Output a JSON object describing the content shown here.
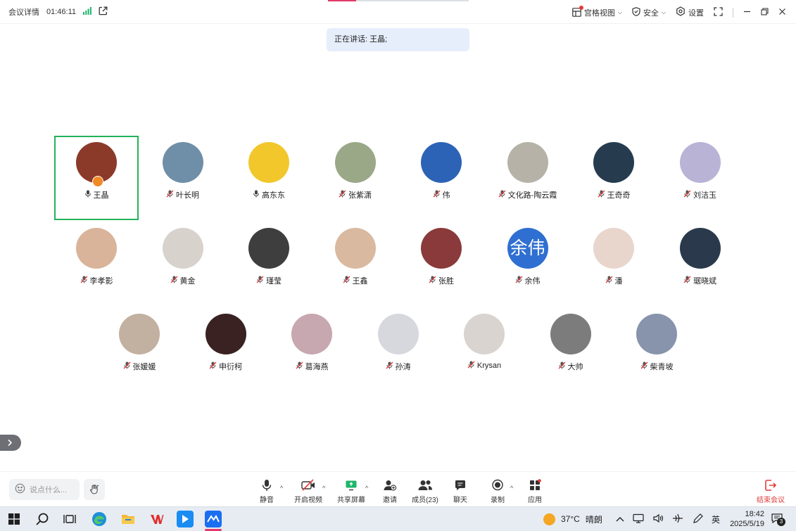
{
  "topbar": {
    "title": "会议详情",
    "timer": "01:46:11",
    "layout_label": "宫格视图",
    "security_label": "安全",
    "settings_label": "设置"
  },
  "speaking": {
    "text": "正在讲话: 王晶;"
  },
  "participants": [
    {
      "name": "王晶",
      "mic": "on",
      "active": true,
      "host": true,
      "color": "#8b3a2a"
    },
    {
      "name": "叶长明",
      "mic": "muted",
      "color": "#6f8fa8"
    },
    {
      "name": "高东东",
      "mic": "on",
      "color": "#f2c72c"
    },
    {
      "name": "张紫潇",
      "mic": "muted",
      "color": "#9aa888"
    },
    {
      "name": "伟",
      "mic": "muted",
      "color": "#2d63b6"
    },
    {
      "name": "文化路-陶云霞",
      "mic": "muted",
      "color": "#b7b2a8"
    },
    {
      "name": "王奇奇",
      "mic": "muted",
      "color": "#263c4e"
    },
    {
      "name": "刘洁玉",
      "mic": "muted",
      "color": "#b9b3d6"
    },
    {
      "name": "李孝影",
      "mic": "muted",
      "color": "#d9b49a"
    },
    {
      "name": "黄金",
      "mic": "muted",
      "color": "#d8d2cc"
    },
    {
      "name": "瑾莹",
      "mic": "muted",
      "color": "#3e3e3e"
    },
    {
      "name": "王鑫",
      "mic": "muted",
      "color": "#d9b9a0"
    },
    {
      "name": "张胜",
      "mic": "muted",
      "color": "#8a3a3a"
    },
    {
      "name": "余伟",
      "mic": "muted",
      "color": "#2f6fd1",
      "initials": "余伟"
    },
    {
      "name": "潘",
      "mic": "muted",
      "color": "#e8d6cc"
    },
    {
      "name": "琚晓斌",
      "mic": "muted",
      "color": "#2a3a4c"
    },
    {
      "name": "张媛媛",
      "mic": "muted",
      "color": "#c2b0a0"
    },
    {
      "name": "申衍柯",
      "mic": "muted",
      "color": "#3a2222"
    },
    {
      "name": "葛海燕",
      "mic": "muted",
      "color": "#c7a7b0"
    },
    {
      "name": "孙涛",
      "mic": "muted",
      "color": "#d6d8de"
    },
    {
      "name": "Krysan",
      "mic": "muted",
      "color": "#d9d4cf"
    },
    {
      "name": "大帅",
      "mic": "muted",
      "color": "#7c7c7c"
    },
    {
      "name": "柴青坡",
      "mic": "muted",
      "color": "#8794ab"
    }
  ],
  "bottombar": {
    "chat_placeholder": "说点什么...",
    "mute": "静音",
    "video": "开启视频",
    "share": "共享屏幕",
    "invite": "邀请",
    "members": "成员(23)",
    "chat": "聊天",
    "record": "录制",
    "apps": "应用",
    "end": "结束会议"
  },
  "taskbar": {
    "temperature": "37°C",
    "weather": "晴朗",
    "ime": "英",
    "time": "18:42",
    "date": "2025/5/19",
    "notifications": "3"
  },
  "colors": {
    "accent_green": "#22b35a",
    "end_red": "#e23a3a",
    "signal_green": "#1db56a"
  }
}
